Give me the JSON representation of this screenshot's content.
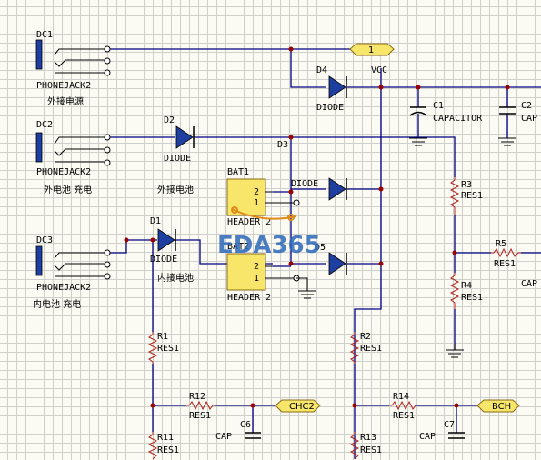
{
  "jacks": [
    {
      "ref": "DC1",
      "part": "PHONEJACK2",
      "note": "外接电源"
    },
    {
      "ref": "DC2",
      "part": "PHONEJACK2",
      "note": "外电池 充电"
    },
    {
      "ref": "DC3",
      "part": "PHONEJACK2",
      "note": "内电池 充电"
    }
  ],
  "diodes": [
    {
      "ref": "D4",
      "part": "DIODE"
    },
    {
      "ref": "D2",
      "part": "DIODE"
    },
    {
      "ref": "D3",
      "part": "DIODE"
    },
    {
      "ref": "D1",
      "part": "DIODE"
    },
    {
      "ref": "D5",
      "part": ""
    }
  ],
  "headers": [
    {
      "ref": "BAT1",
      "part": "HEADER 2",
      "pin1": "1",
      "pin2": "2",
      "note": "外接电池"
    },
    {
      "ref": "BAT2",
      "part": "HEADER 2",
      "pin1": "1",
      "pin2": "2",
      "note": "内接电池"
    }
  ],
  "capacitors": [
    {
      "ref": "C1",
      "part": "CAPACITOR"
    },
    {
      "ref": "C2",
      "part": "CAP"
    },
    {
      "ref": "C6",
      "part": "CAP"
    },
    {
      "ref": "C7",
      "part": "CAP"
    },
    {
      "ref": "",
      "part": "CAP"
    }
  ],
  "resistors": [
    {
      "ref": "R3",
      "part": "RES1"
    },
    {
      "ref": "R4",
      "part": "RES1"
    },
    {
      "ref": "R5",
      "part": "RES1"
    },
    {
      "ref": "R1",
      "part": "RES1"
    },
    {
      "ref": "R2",
      "part": "RES1"
    },
    {
      "ref": "R12",
      "part": "RES1"
    },
    {
      "ref": "R14",
      "part": "RES1"
    },
    {
      "ref": "R11",
      "part": "RES1"
    },
    {
      "ref": "R13",
      "part": "RES1"
    }
  ],
  "ports": [
    {
      "name": "1"
    },
    {
      "name": "CHC2"
    },
    {
      "name": "BCH"
    }
  ],
  "net_labels": {
    "vcc": "VCC"
  },
  "watermark": "EDA365",
  "colors": {
    "wire": "#000082",
    "junction": "#9b0000",
    "resistor": "#b0201a",
    "port_fill": "#f7e66a",
    "grid": "#cfd0cc",
    "sheet": "#fbfbf3",
    "watermark": "#2a66b8"
  }
}
